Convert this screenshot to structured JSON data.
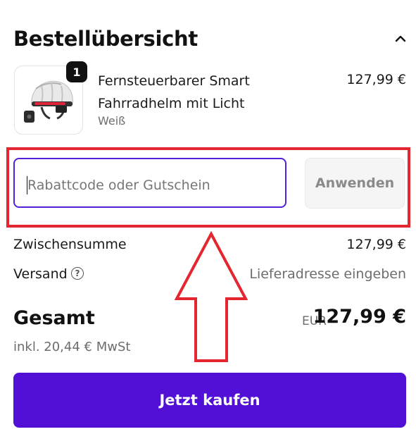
{
  "summary": {
    "title": "Bestellübersicht",
    "toggle_icon": "chevron-up-icon"
  },
  "product": {
    "quantity_badge": "1",
    "name": "Fernsteuerbarer Smart Fahrradhelm mit Licht",
    "variant": "Weiß",
    "price": "127,99 €",
    "image_icon": "bike-helmet-icon"
  },
  "discount": {
    "placeholder": "Rabattcode oder Gutschein",
    "apply_label": "Anwenden"
  },
  "totals": {
    "subtotal_label": "Zwischensumme",
    "subtotal_value": "127,99 €",
    "shipping_label": "Versand",
    "shipping_help_icon": "question-circle-icon",
    "shipping_value": "Lieferadresse eingeben",
    "total_label": "Gesamt",
    "currency": "EUR",
    "total_value": "127,99 €",
    "tax_note": "inkl. 20,44 € MwSt"
  },
  "checkout": {
    "buy_label": "Jetzt kaufen"
  },
  "colors": {
    "accent": "#5210d6",
    "focus_border": "#5321d8",
    "annotation_red": "#e3262f"
  }
}
